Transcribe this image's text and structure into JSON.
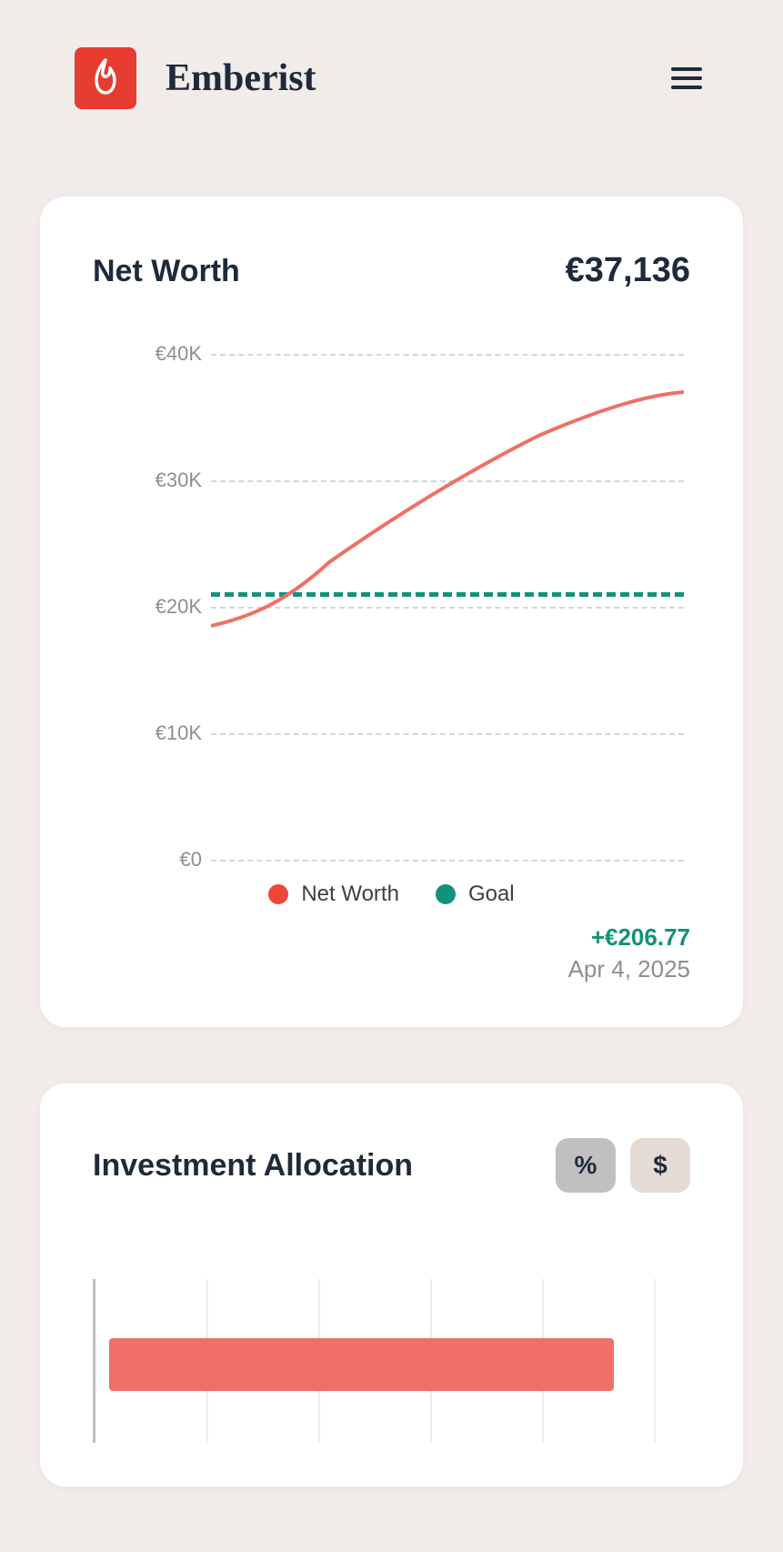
{
  "brand": "Emberist",
  "net_worth_card": {
    "title": "Net Worth",
    "value": "€37,136",
    "delta": "+€206.77",
    "date": "Apr 4, 2025",
    "legend": {
      "net_worth": "Net Worth",
      "goal": "Goal"
    }
  },
  "allocation_card": {
    "title": "Investment Allocation",
    "toggle_percent": "%",
    "toggle_currency": "$"
  },
  "chart_data": {
    "type": "line",
    "ylabel": "",
    "xlabel": "",
    "ylim": [
      0,
      40000
    ],
    "y_ticks": [
      "€0",
      "€10K",
      "€20K",
      "€30K",
      "€40K"
    ],
    "series": [
      {
        "name": "Net Worth",
        "color": "#ee7066",
        "x": [
          0,
          0.25,
          0.5,
          0.75,
          1.0
        ],
        "values": [
          18500,
          23500,
          28000,
          32500,
          37000
        ]
      },
      {
        "name": "Goal",
        "color": "#13927a",
        "style": "dashed",
        "x": [
          0,
          1.0
        ],
        "values": [
          21000,
          21000
        ]
      }
    ]
  },
  "colors": {
    "brand_red": "#e63c32",
    "line_red": "#ee7066",
    "teal": "#13927a",
    "text": "#1e2a3b",
    "muted": "#8a8f94"
  }
}
